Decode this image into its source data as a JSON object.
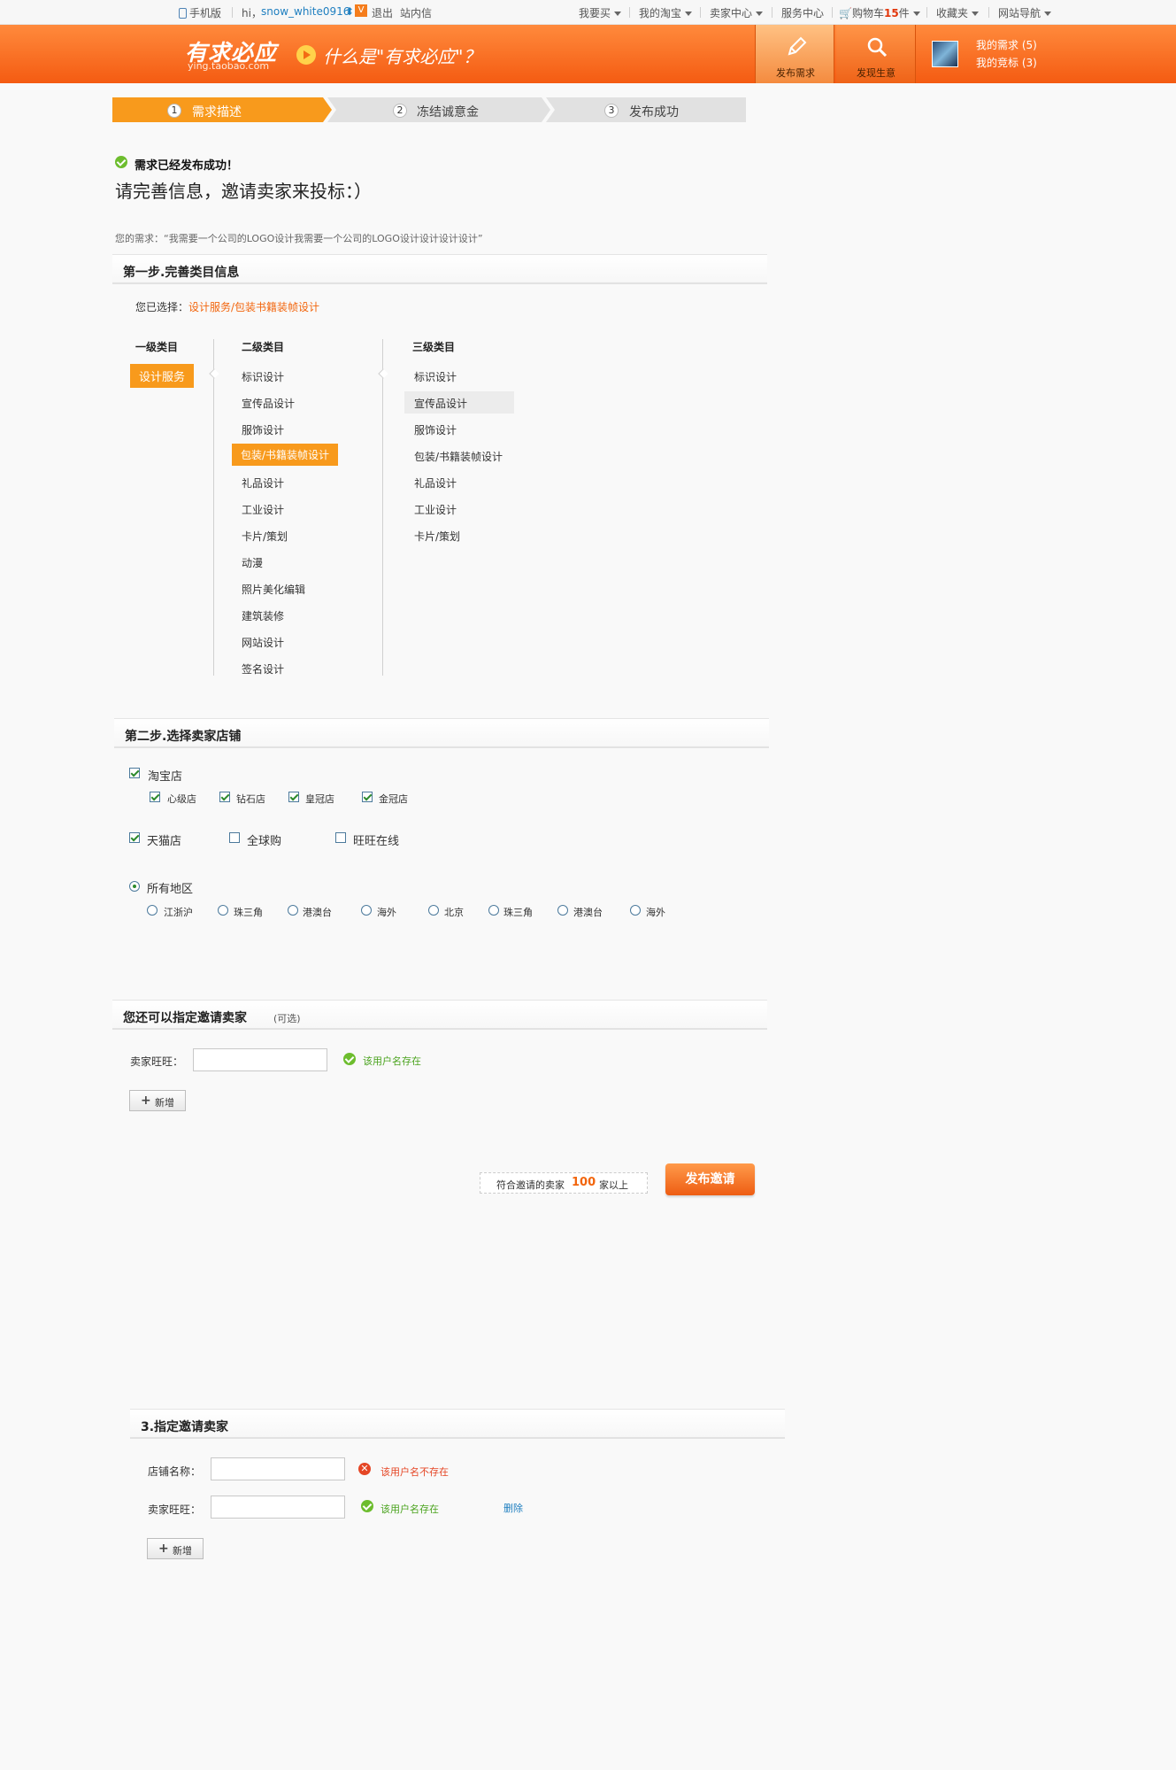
{
  "topbar": {
    "mobile": "手机版",
    "hi": "hi，",
    "username": "snow_white0916",
    "logout": "退出",
    "inbox": "站内信",
    "want_buy": "我要买",
    "my_taobao": "我的淘宝",
    "seller_center": "卖家中心",
    "service_center": "服务中心",
    "cart_prefix": "购物车",
    "cart_count": "15",
    "cart_suffix": "件",
    "favorites": "收藏夹",
    "site_nav": "网站导航"
  },
  "header": {
    "logo": "有求必应",
    "logo_url": "ying.taobao.com",
    "slogan": "什么是\"有求必应\"？",
    "publish_label": "发布需求",
    "discover_label": "发现生意",
    "my_needs": "我的需求 (5)",
    "my_bids": "我的竞标 (3)"
  },
  "steps": [
    {
      "num": "1",
      "label": "需求描述"
    },
    {
      "num": "2",
      "label": "冻结诚意金"
    },
    {
      "num": "3",
      "label": "发布成功"
    }
  ],
  "success": {
    "message": "需求已经发布成功！",
    "title": "请完善信息，邀请卖家来投标：）",
    "demand": "您的需求：“我需要一个公司的LOGO设计我需要一个公司的LOGO设计设计设计设计”"
  },
  "section1": {
    "title": "第一步.完善类目信息",
    "chosen_label": "您已选择：",
    "chosen_value": "设计服务/包装书籍装帧设计",
    "col1_title": "一级类目",
    "col2_title": "二级类目",
    "col3_title": "三级类目",
    "col1": [
      "设计服务"
    ],
    "col2": [
      "标识设计",
      "宣传品设计",
      "服饰设计",
      "包装/书籍装帧设计",
      "礼品设计",
      "工业设计",
      "卡片/策划",
      "动漫",
      "照片美化编辑",
      "建筑装修",
      "网站设计",
      "签名设计"
    ],
    "col3": [
      "标识设计",
      "宣传品设计",
      "服饰设计",
      "包装/书籍装帧设计",
      "礼品设计",
      "工业设计",
      "卡片/策划"
    ]
  },
  "section2": {
    "title": "第二步.选择卖家店铺",
    "taobao": "淘宝店",
    "levels": [
      "心级店",
      "钻石店",
      "皇冠店",
      "金冠店"
    ],
    "tmall": "天猫店",
    "global": "全球购",
    "wangwang": "旺旺在线",
    "all_regions": "所有地区",
    "regions": [
      "江浙沪",
      "珠三角",
      "港澳台",
      "海外",
      "北京",
      "珠三角",
      "港澳台",
      "海外"
    ]
  },
  "section3": {
    "title": "您还可以指定邀请卖家",
    "optional": "(可选)",
    "seller_label": "卖家旺旺：",
    "seller_value": "",
    "ok_text": "该用户名存在",
    "add_label": "新增",
    "match_prefix": "符合邀请的卖家",
    "match_count": "100",
    "match_suffix": "家以上",
    "publish_button": "发布邀请"
  },
  "section4": {
    "title": "3.指定邀请卖家",
    "shop_label": "店铺名称：",
    "shop_value": "",
    "error_text": "该用户名不存在",
    "seller_label": "卖家旺旺：",
    "seller_value": "",
    "ok_text": "该用户名存在",
    "delete_label": "删除",
    "add_label": "新增"
  }
}
